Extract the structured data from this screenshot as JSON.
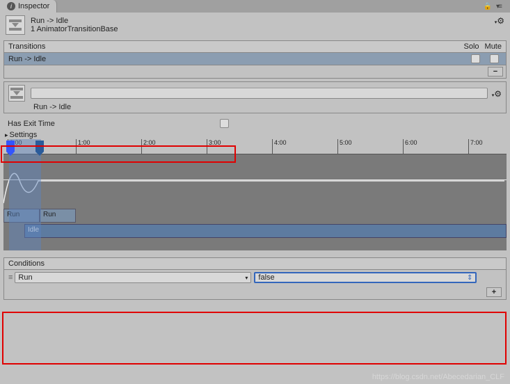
{
  "tab": {
    "title": "Inspector"
  },
  "header": {
    "title": "Run -> Idle",
    "subtitle": "1 AnimatorTransitionBase"
  },
  "transitions": {
    "header": "Transitions",
    "col_solo": "Solo",
    "col_mute": "Mute",
    "items": [
      {
        "label": "Run -> Idle"
      }
    ],
    "minus": "−"
  },
  "nameRow": {
    "label": "Run -> Idle"
  },
  "exitTime": {
    "label": "Has Exit Time"
  },
  "settings": {
    "label": "Settings"
  },
  "timeline": {
    "ticks": [
      "0:00",
      "1:00",
      "2:00",
      "3:00",
      "4:00",
      "5:00",
      "6:00",
      "7:00"
    ],
    "clipA": "Run",
    "clipA2": "Run",
    "clipB": "Idle"
  },
  "conditions": {
    "header": "Conditions",
    "rows": [
      {
        "param": "Run",
        "value": "false"
      }
    ],
    "plus": "+"
  },
  "watermark": "https://blog.csdn.net/Abecedarian_CLF"
}
